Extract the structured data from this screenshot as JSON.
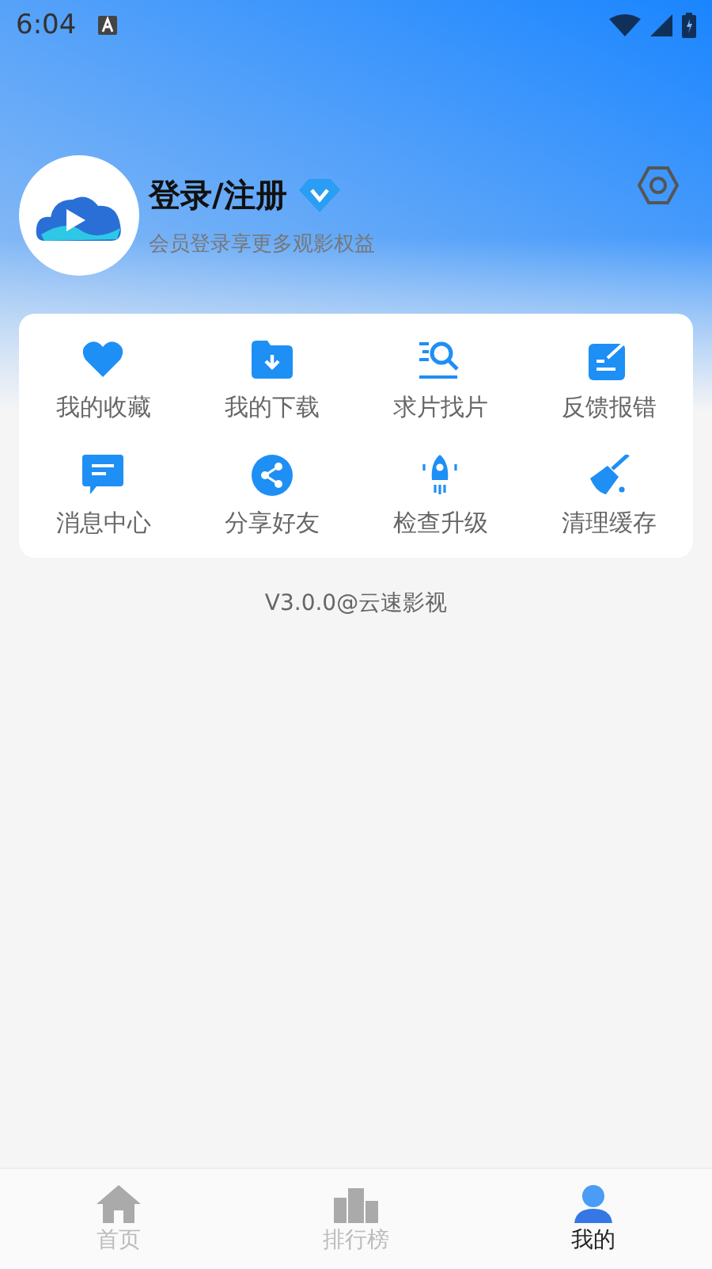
{
  "status_bar": {
    "time": "6:04"
  },
  "profile": {
    "title": "登录/注册",
    "subtitle": "会员登录享更多观影权益"
  },
  "menu": [
    {
      "kind": "heart",
      "label": "我的收藏"
    },
    {
      "kind": "download",
      "label": "我的下载"
    },
    {
      "kind": "search",
      "label": "求片找片"
    },
    {
      "kind": "feedback",
      "label": "反馈报错"
    },
    {
      "kind": "message",
      "label": "消息中心"
    },
    {
      "kind": "share",
      "label": "分享好友"
    },
    {
      "kind": "rocket",
      "label": "检查升级"
    },
    {
      "kind": "broom",
      "label": "清理缓存"
    }
  ],
  "version": "V3.0.0@云速影视",
  "tabs": [
    {
      "kind": "home",
      "label": "首页",
      "selected": false
    },
    {
      "kind": "rank",
      "label": "排行榜",
      "selected": false
    },
    {
      "kind": "me",
      "label": "我的",
      "selected": true
    }
  ]
}
